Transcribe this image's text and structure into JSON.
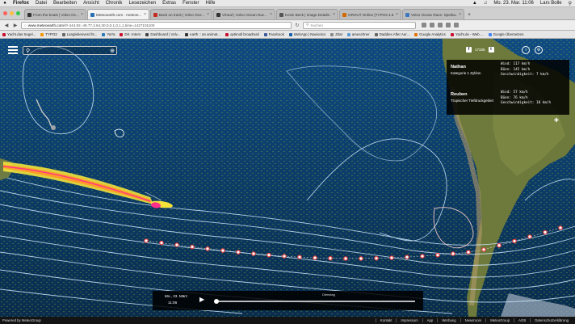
{
  "menubar": {
    "apple": "",
    "items": [
      "Firefox",
      "Datei",
      "Bearbeiten",
      "Ansicht",
      "Chronik",
      "Lesezeichen",
      "Extras",
      "Fenster",
      "Hilfe"
    ],
    "clock": "Mo. 23. Mar. 11:06",
    "user": "Lars Bolle"
  },
  "tabs": [
    {
      "title": "From the boats | Volvo Oc...",
      "color": "#333333",
      "active": false
    },
    {
      "title": "Meteoearth.com - meteoe...",
      "color": "#2a6fb0",
      "active": true
    },
    {
      "title": "Back on track | Volvo Oce...",
      "color": "#c42a20",
      "active": false
    },
    {
      "title": "Virtual | Volvo Ocean Rac...",
      "color": "#333333",
      "active": false
    },
    {
      "title": "Kevin Beck | Image Details ...",
      "color": "#555555",
      "active": false
    },
    {
      "title": "GROUT Online [TYPO3 4.5...",
      "color": "#d26a00",
      "active": false
    },
    {
      "title": "Volvo Ocean Race: Spekta...",
      "color": "#3c78c0",
      "active": false
    }
  ],
  "urlbar": {
    "host": "www.meteoearth.com",
    "path": "/#/-244.92,-49.77,2.64,30,0,0,1,0,1,1,time=1427101100",
    "search_placeholder": "Suchen"
  },
  "bookmarks": [
    {
      "label": "Yacht.das Segel...",
      "color": "#c8102e"
    },
    {
      "label": "TYPO3",
      "color": "#f49700"
    },
    {
      "label": "Langlebenverd ht...",
      "color": "#666666"
    },
    {
      "label": "YaYa",
      "color": "#2a7ab8"
    },
    {
      "label": "DK -Intern",
      "color": "#c8102e"
    },
    {
      "label": "Dashboard | Volv...",
      "color": "#444444"
    },
    {
      "label": "earth :: an animat...",
      "color": "#333333"
    },
    {
      "label": "optimoll broadmail",
      "color": "#c8102e"
    },
    {
      "label": "Facebook",
      "color": "#3b5998"
    },
    {
      "label": "WebApp | Navionics",
      "color": "#1a5fa8"
    },
    {
      "label": "Zitat",
      "color": "#888888"
    },
    {
      "label": "ameschner",
      "color": "#5a9ad6"
    },
    {
      "label": "Daddies After Aer...",
      "color": "#666666"
    },
    {
      "label": "Google Analytics",
      "color": "#e37400"
    },
    {
      "label": "Yacht.de - Web ...",
      "color": "#c8102e"
    },
    {
      "label": "Google Übersetzen",
      "color": "#4285f4"
    }
  ],
  "social": {
    "facebook_count": "17335",
    "facebook_glyph": "f",
    "twitter_glyph": "t"
  },
  "map_buttons": {
    "info": "i",
    "settings": "⚙"
  },
  "storms": [
    {
      "name": "Nathan",
      "category": "Kategorie 1 Zyklon",
      "stats": "Wind: 117 km/h\nBöen: 145 km/h\nGeschwindigkeit: 7 km/h"
    },
    {
      "name": "Reuben",
      "category": "Tropischer Tiefdruckgebiet",
      "stats": "Wind: 57 km/h\nBöen: 76 km/h\nGeschwindigkeit: 18 km/h"
    }
  ],
  "timeline": {
    "date": "Mo., 23. März",
    "time": "11:06",
    "day_label": "Dienstag",
    "progress": 0.0
  },
  "footer": {
    "brand": "Powered by MeteoGroup",
    "links": [
      "Kontakt",
      "Impressum",
      "App",
      "Werbung",
      "Newsroom",
      "MeteoGroup",
      "AGB",
      "Datenschutzerklärung"
    ]
  },
  "colors": {
    "ocean": "#0d3a67",
    "isobar": "#cfe8ff",
    "pressure_high": "#f2c8c8",
    "track_dot": "#ffffff",
    "track_red": "#e03c3c",
    "storm_yellow": "#f2e23a",
    "storm_pink": "#ff2f8a"
  }
}
